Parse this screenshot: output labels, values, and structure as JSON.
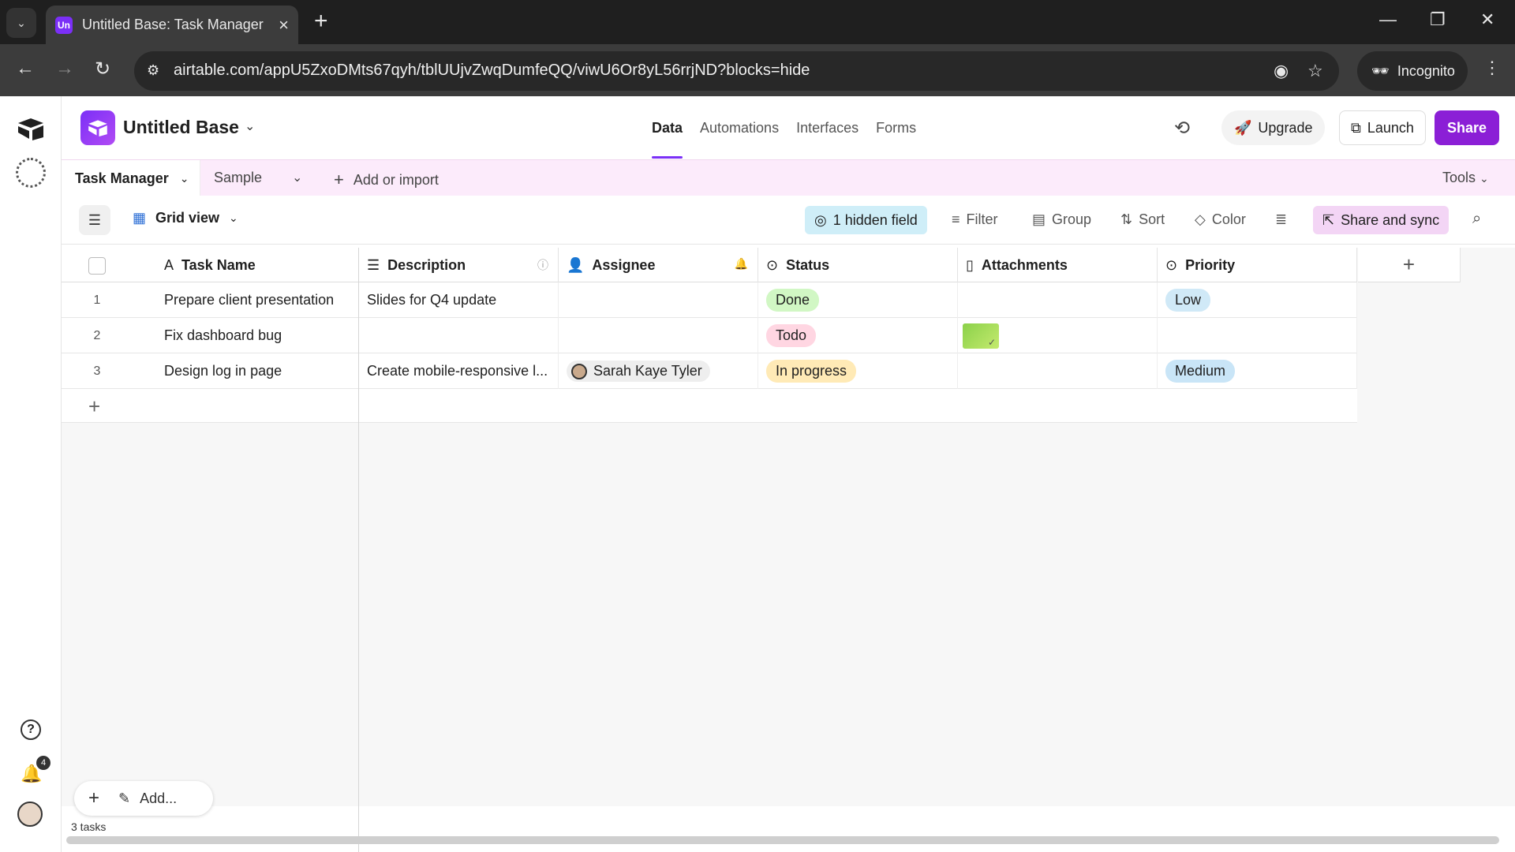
{
  "browser": {
    "tab_favicon": "Un",
    "tab_title": "Untitled Base: Task Manager - A",
    "url": "airtable.com/appU5ZxoDMts67qyh/tblUUjvZwqDumfeQQ/viwU6Or8yL56rrjND?blocks=hide",
    "incognito_label": "Incognito"
  },
  "header": {
    "base_name": "Untitled Base",
    "nav": [
      "Data",
      "Automations",
      "Interfaces",
      "Forms"
    ],
    "active_nav": "Data",
    "upgrade_label": "Upgrade",
    "launch_label": "Launch",
    "share_label": "Share"
  },
  "tables_bar": {
    "active_table": "Task Manager",
    "other_table": "Sample",
    "add_import_label": "Add or import",
    "tools_label": "Tools"
  },
  "view_bar": {
    "view_name": "Grid view",
    "hidden_fields_label": "1 hidden field",
    "filter_label": "Filter",
    "group_label": "Group",
    "sort_label": "Sort",
    "color_label": "Color",
    "share_sync_label": "Share and sync"
  },
  "grid": {
    "columns": [
      "Task Name",
      "Description",
      "Assignee",
      "Status",
      "Attachments",
      "Priority"
    ],
    "rows": [
      {
        "num": "1",
        "task": "Prepare client presentation",
        "description": "Slides for Q4 update",
        "assignee": "",
        "status": "Done",
        "attachment": false,
        "priority": "Low"
      },
      {
        "num": "2",
        "task": "Fix dashboard bug",
        "description": "",
        "assignee": "",
        "status": "Todo",
        "attachment": true,
        "priority": ""
      },
      {
        "num": "3",
        "task": "Design log in page",
        "description": "Create mobile-responsive l...",
        "assignee": "Sarah Kaye Tyler",
        "status": "In progress",
        "attachment": false,
        "priority": "Medium"
      }
    ]
  },
  "footer": {
    "add_label": "Add...",
    "record_count": "3 tasks",
    "notification_count": "4"
  },
  "colors": {
    "accent": "#7b2ff7",
    "share_button": "#8b1fd6",
    "status_done": "#d1f7c4",
    "status_todo": "#ffd6e2",
    "status_in_progress": "#ffeab6",
    "priority": "#d0e9f7"
  }
}
